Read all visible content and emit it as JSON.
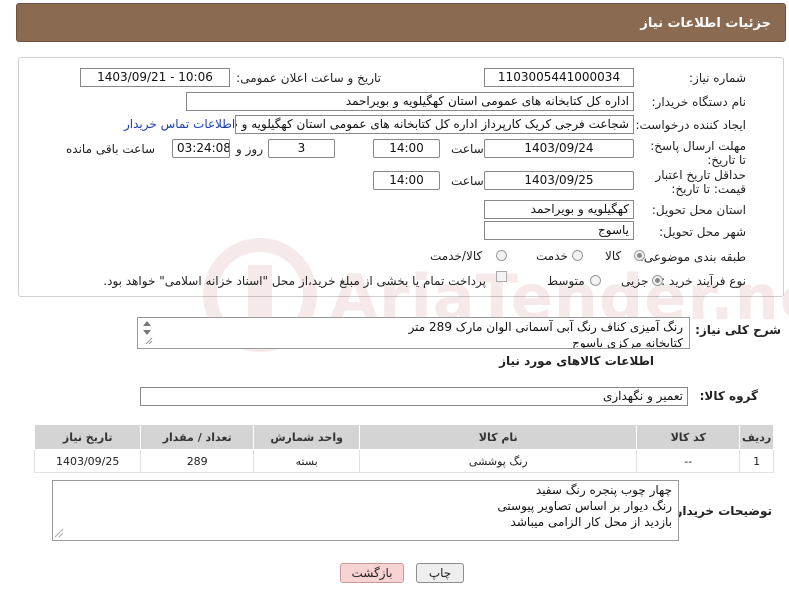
{
  "header": {
    "title": "جزئیات اطلاعات نیاز"
  },
  "fields": {
    "need_number_label": "شماره نیاز:",
    "need_number": "1103005441000034",
    "announce_label": "تاریخ و ساعت اعلان عمومی:",
    "announce_value": "1403/09/21 - 10:06",
    "buyer_org_label": "نام دستگاه خریدار:",
    "buyer_org": "اداره کل کتابخانه های عمومی استان کهگیلویه و بویراحمد",
    "creator_label": "ایجاد کننده درخواست:",
    "creator": "شجاعت فرجی کریک کارپرداز اداره کل کتابخانه های عمومی استان کهگیلویه و ب",
    "contact_link": "اطلاعات تماس خریدار",
    "reply_deadline_label": "مهلت ارسال پاسخ: تا تاریخ:",
    "reply_date": "1403/09/24",
    "time_label": "ساعت",
    "reply_time": "14:00",
    "days_value": "3",
    "days_label": "روز و",
    "remaining_time": "03:24:08",
    "remaining_label": "ساعت باقی مانده",
    "price_validity_label": "حداقل تاریخ اعتبار قیمت: تا تاریخ:",
    "price_date": "1403/09/25",
    "price_time": "14:00",
    "province_label": "استان محل تحویل:",
    "province": "کهگیلویه و بویراحمد",
    "city_label": "شهر محل تحویل:",
    "city": "یاسوج",
    "category_label": "طبقه بندی موضوعی:",
    "category_options": [
      "کالا",
      "خدمت",
      "کالا/خدمت"
    ],
    "process_label": "نوع فرآیند خرید :",
    "process_options": [
      "جزیی",
      "متوسط"
    ],
    "payment_note": "پرداخت تمام یا بخشی از مبلغ خرید،از محل \"اسناد خزانه اسلامی\" خواهد بود."
  },
  "summary": {
    "label": "شرح کلی نیاز:",
    "lines": [
      "رنگ آمیزی کناف رنگ آبی آسمانی الوان مارک 289 متر",
      "کتابخانه مرکزی یاسوج"
    ]
  },
  "goods": {
    "section_title": "اطلاعات کالاهای مورد نیاز",
    "group_label": "گروه کالا:",
    "group_value": "تعمیر و نگهداری",
    "columns": [
      "ردیف",
      "کد کالا",
      "نام کالا",
      "واحد شمارش",
      "تعداد / مقدار",
      "تاریخ نیاز"
    ],
    "rows": [
      [
        "1",
        "--",
        "رنگ پوششی",
        "بسته",
        "289",
        "1403/09/25"
      ]
    ]
  },
  "buyer_notes": {
    "label": "توضیحات خریدار:",
    "lines": [
      "چهار چوب پنجره رنگ سفید",
      "رنگ دیوار بر اساس تصاویر پیوستی",
      "بازدید از محل کار الزامی میباشد"
    ]
  },
  "buttons": {
    "print": "چاپ",
    "back": "بازگشت"
  },
  "watermark": {
    "text": "AriaTender.neT"
  },
  "colors": {
    "header_bg": "#8a6b52",
    "link": "#1a3fb5",
    "back_button": "#f7d3d3"
  }
}
